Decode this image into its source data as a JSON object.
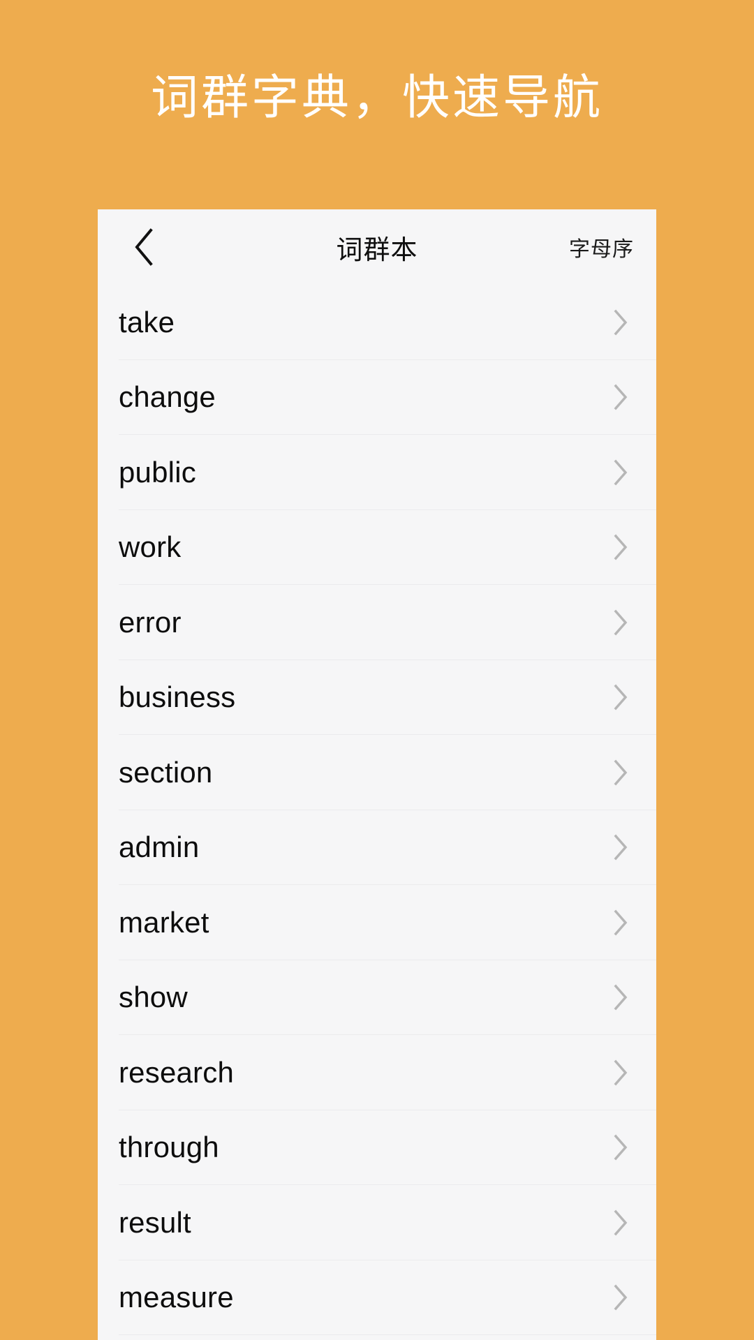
{
  "hero": {
    "title": "词群字典，快速导航",
    "background_color": "#eeac4e",
    "text_color": "#ffffff"
  },
  "card": {
    "background_color": "#f6f6f7",
    "divider_color": "#ebebed"
  },
  "nav": {
    "back_icon": "chevron-left-icon",
    "title": "词群本",
    "action_label": "字母序"
  },
  "list": {
    "row_chevron_icon": "chevron-right-icon",
    "chevron_color": "#b6b6b6",
    "items": [
      {
        "word": "take"
      },
      {
        "word": "change"
      },
      {
        "word": "public"
      },
      {
        "word": "work"
      },
      {
        "word": "error"
      },
      {
        "word": "business"
      },
      {
        "word": "section"
      },
      {
        "word": "admin"
      },
      {
        "word": "market"
      },
      {
        "word": "show"
      },
      {
        "word": "research"
      },
      {
        "word": "through"
      },
      {
        "word": "result"
      },
      {
        "word": "measure"
      }
    ]
  }
}
